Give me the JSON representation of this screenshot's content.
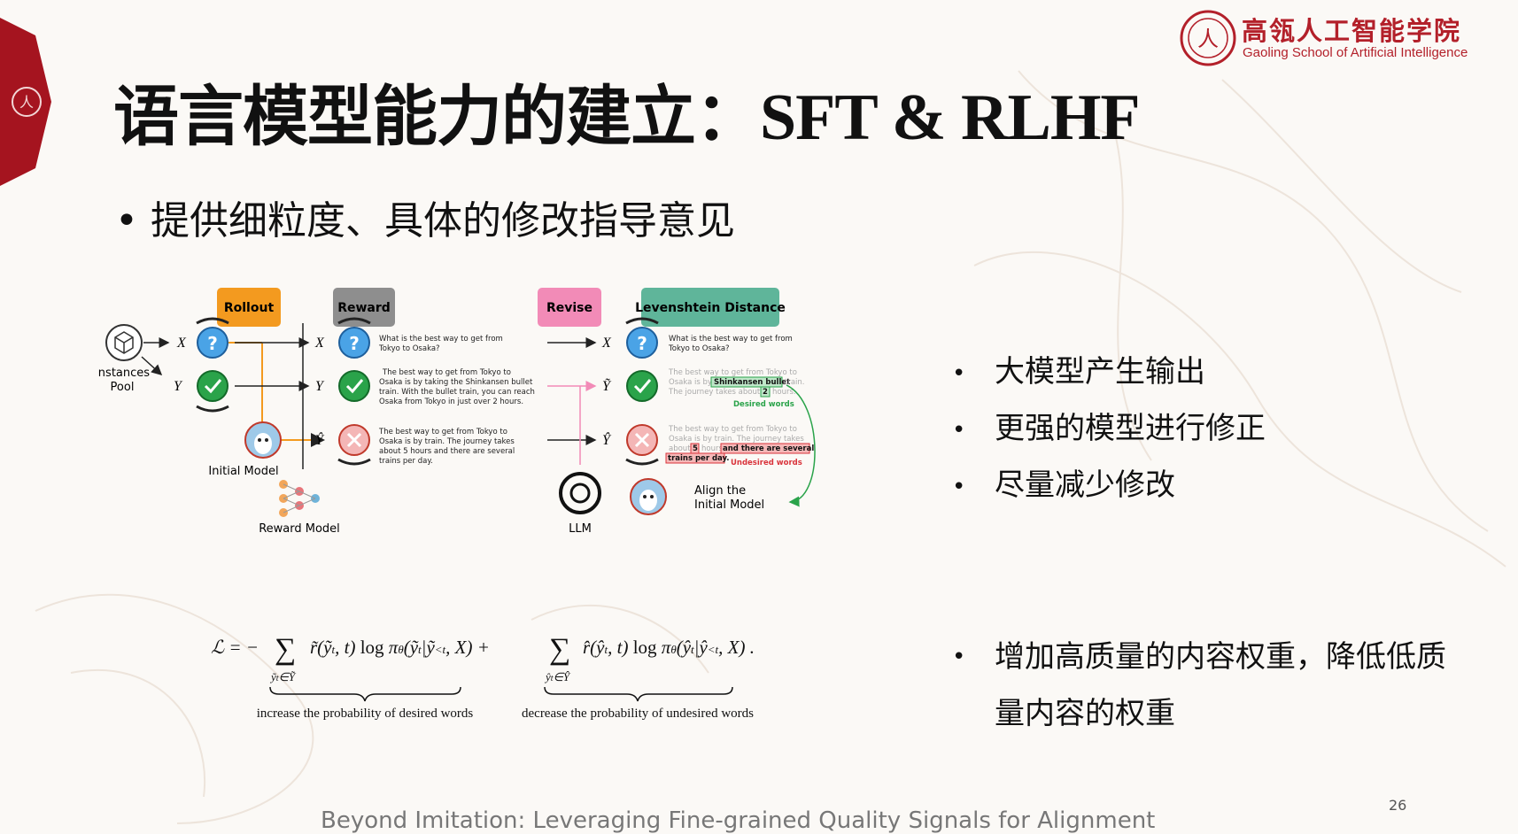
{
  "header": {
    "logo_cn": "高瓴人工智能学院",
    "logo_en": "Gaoling School of Artificial Intelligence"
  },
  "slide": {
    "title_cn": "语言模型能力的建立：",
    "title_latin": "SFT & RLHF",
    "main_bullet": "• 提供细粒度、具体的修改指导意见",
    "right_bullets": [
      "大模型产生输出",
      "更强的模型进行修正",
      "尽量减少修改"
    ],
    "right_bullet_long": "增加高质量的内容权重，降低低质量内容的权重",
    "reference": "Beyond Imitation: Leveraging Fine-grained Quality Signals for Alignment",
    "page_number": "26"
  },
  "figure": {
    "stage_labels": {
      "rollout": "Rollout",
      "reward": "Reward",
      "revise": "Revise",
      "levenshtein": "Levenshtein Distance"
    },
    "colors": {
      "rollout": "#f39a1f",
      "reward": "#8e8e8e",
      "revise": "#f28bb7",
      "levenshtein": "#5fb59a"
    },
    "instances_pool": [
      "Instances",
      "Pool"
    ],
    "var_x": "X",
    "var_y": "Y",
    "var_yhat": "Ŷ",
    "var_ytilde": "Ỹ",
    "question_text": [
      "What is the best way to get from",
      "Tokyo to Osaka?"
    ],
    "good_answer": [
      "The best way to get from Tokyo to",
      "Osaka is by taking the Shinkansen bullet",
      "train. With the bullet train, you can reach",
      "Osaka from Tokyo in just over 2 hours."
    ],
    "bad_answer": [
      "The best way to get from Tokyo to",
      "Osaka is by train. The journey takes",
      "about 5 hours and there are several",
      "trains per day."
    ],
    "initial_model": "Initial Model",
    "reward_model": "Reward Model",
    "llm": "LLM",
    "revised_answer": [
      "The best way to get from Tokyo to",
      "Osaka is by",
      "Shinkansen bullet",
      "train.",
      "The journey takes about",
      "2",
      "hours."
    ],
    "desired_words": "Desired words",
    "undesired_answer": [
      "The best way to get from Tokyo to",
      "Osaka is by train. The journey takes",
      "about",
      "5",
      "hours",
      "and there are several",
      "trains per day."
    ],
    "undesired_words": "Undesired words",
    "align_label": [
      "Align the",
      "Initial Model"
    ]
  },
  "formula": {
    "brace_left": "increase the probability of desired words",
    "brace_right": "decrease the probability of undesired words"
  }
}
